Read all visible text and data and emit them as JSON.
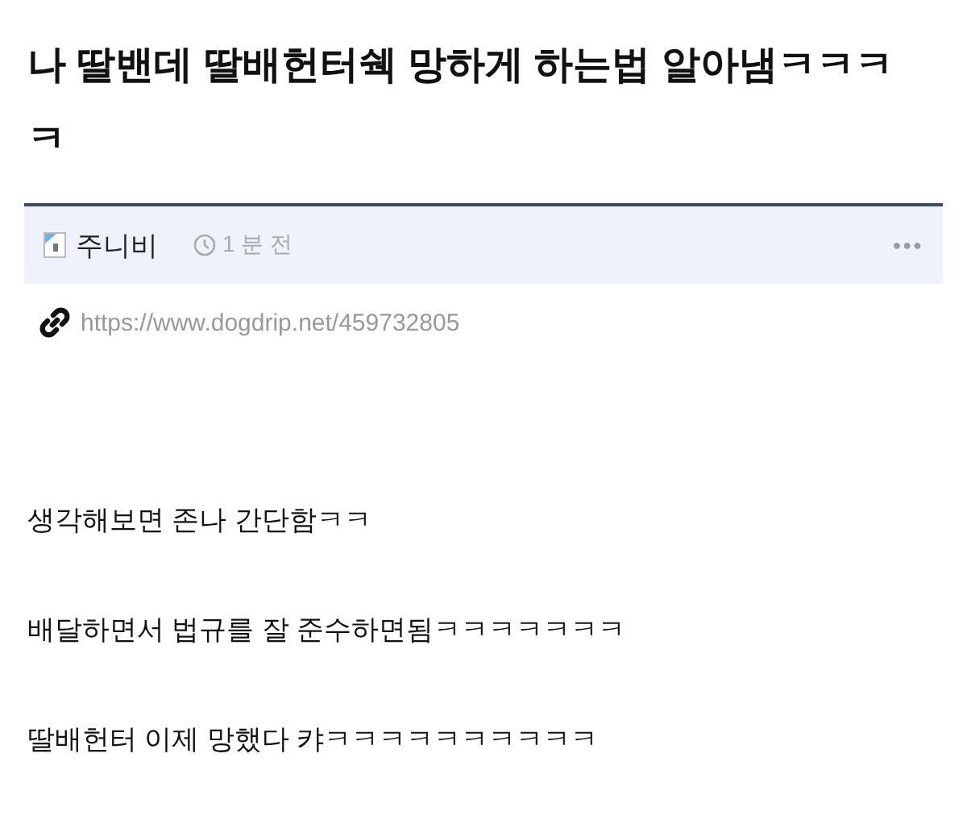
{
  "post": {
    "title": "나 딸밴데 딸배헌터쉑 망하게 하는법 알아냄ㅋㅋㅋㅋ",
    "author": "주니비",
    "time": "1 분 전",
    "more": "●●●",
    "url": "https://www.dogdrip.net/459732805"
  },
  "body": [
    "생각해보면 존나 간단함ㅋㅋ",
    "배달하면서 법규를 잘 준수하면됨ㅋㅋㅋㅋㅋㅋㅋ",
    "딸배헌터 이제 망했다 캬ㅋㅋㅋㅋㅋㅋㅋㅋㅋㅋ"
  ]
}
